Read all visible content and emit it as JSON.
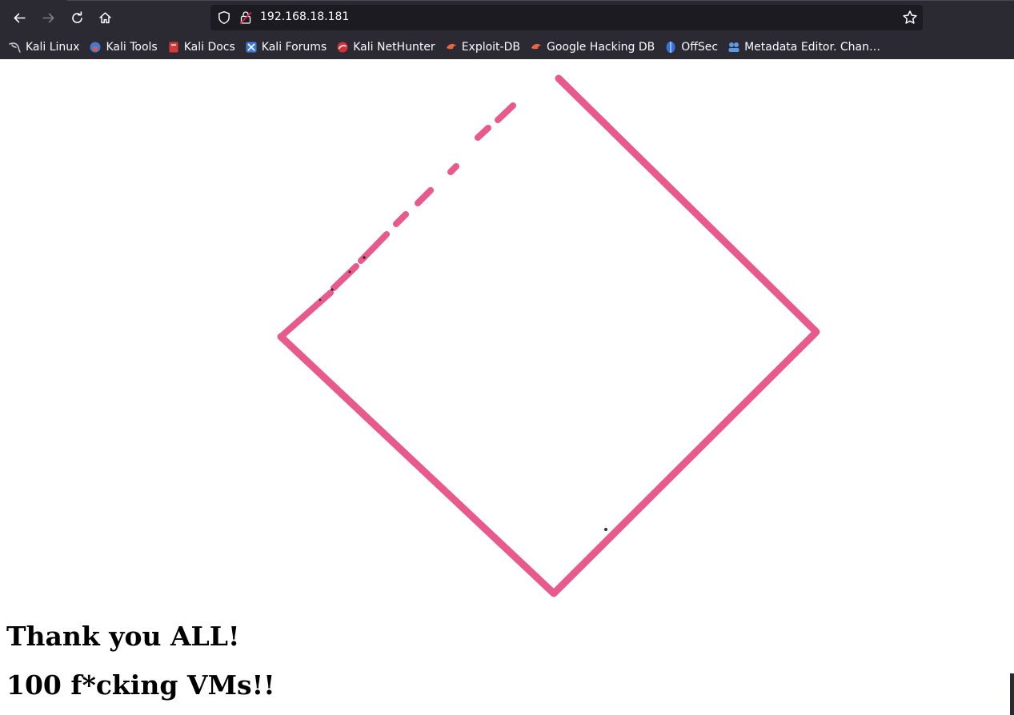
{
  "browser": {
    "url": "192.168.18.181",
    "icons": [
      "back-arrow-icon",
      "forward-arrow-icon",
      "reload-icon",
      "home-icon",
      "shield-icon",
      "lock-icon",
      "star-icon"
    ],
    "colors": {
      "chrome": "#2b2a33",
      "urlbar": "#1c1b22",
      "text": "#fbfbfe"
    }
  },
  "bookmarks": [
    {
      "label": "Kali Linux",
      "icon": "kali-dragon-icon"
    },
    {
      "label": "Kali Tools",
      "icon": "kali-tools-icon"
    },
    {
      "label": "Kali Docs",
      "icon": "kali-docs-icon"
    },
    {
      "label": "Kali Forums",
      "icon": "kali-forums-icon"
    },
    {
      "label": "Kali NetHunter",
      "icon": "nethunter-icon"
    },
    {
      "label": "Exploit-DB",
      "icon": "exploit-db-icon"
    },
    {
      "label": "Google Hacking DB",
      "icon": "ghdb-icon"
    },
    {
      "label": "OffSec",
      "icon": "offsec-icon"
    },
    {
      "label": "Metadata Editor. Chan…",
      "icon": "metadata-editor-icon"
    }
  ],
  "page": {
    "heading1": "Thank you ALL!",
    "heading2": "100 f*cking VMs!!",
    "image": {
      "icon": "pink-diamond-outline",
      "color": "#e85a8b"
    }
  }
}
